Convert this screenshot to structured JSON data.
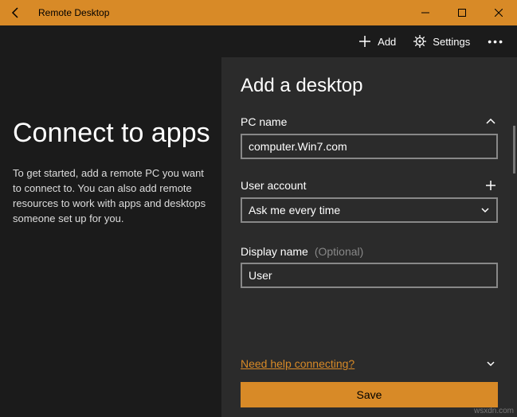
{
  "titlebar": {
    "title": "Remote Desktop"
  },
  "toolbar": {
    "add_label": "Add",
    "settings_label": "Settings"
  },
  "left": {
    "heading": "Connect to apps",
    "description": "To get started, add a remote PC you want to connect to. You can also add remote resources to work with apps and desktops someone set up for you."
  },
  "panel": {
    "title": "Add a desktop",
    "pc_name_label": "PC name",
    "pc_name_value": "computer.Win7.com",
    "user_account_label": "User account",
    "user_account_value": "Ask me every time",
    "display_name_label": "Display name",
    "display_name_hint": "(Optional)",
    "display_name_value": "User",
    "help_link": "Need help connecting?",
    "save_label": "Save"
  },
  "watermark": "wsxdn.com"
}
